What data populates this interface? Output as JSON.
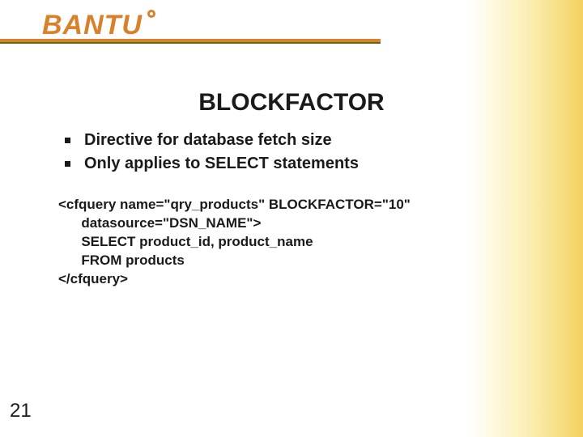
{
  "logo": {
    "text": "BANTU"
  },
  "title": "BLOCKFACTOR",
  "bullets": [
    "Directive for database fetch size",
    "Only applies to SELECT statements"
  ],
  "code": "<cfquery name=\"qry_products\" BLOCKFACTOR=\"10\"\n      datasource=\"DSN_NAME\">\n      SELECT product_id, product_name\n      FROM products\n</cfquery>",
  "page_number": "21"
}
